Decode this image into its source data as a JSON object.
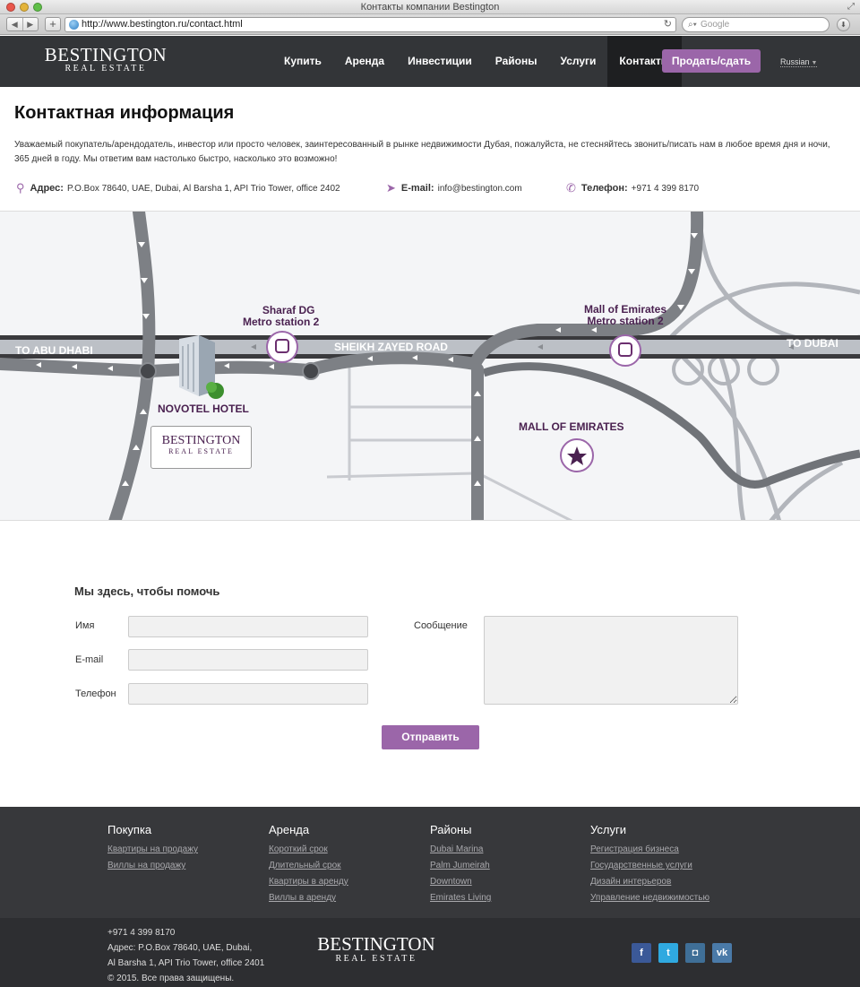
{
  "browser": {
    "window_title": "Контакты компании Bestington",
    "url": "http://www.bestington.ru/contact.html",
    "search_placeholder": "Google"
  },
  "header": {
    "logo_main": "BESTINGTON",
    "logo_sub": "REAL ESTATE",
    "nav": [
      {
        "label": "Купить"
      },
      {
        "label": "Аренда"
      },
      {
        "label": "Инвестиции"
      },
      {
        "label": "Районы"
      },
      {
        "label": "Услуги"
      },
      {
        "label": "Контакты",
        "active": true
      }
    ],
    "sell_button": "Продать/сдать",
    "language": "Russian"
  },
  "contact": {
    "title": "Контактная информация",
    "intro": "Уважаемый покупатель/арендодатель, инвестор или просто человек, заинтересованный в рынке недвижимости Дубая, пожалуйста, не стесняйтесь звонить/писать нам в любое время дня и ночи, 365 дней в году. Мы ответим вам настолько быстро, насколько это возможно!",
    "address_label": "Адрес:",
    "address_value": "P.O.Box 78640, UAE, Dubai, Al Barsha 1, API Trio Tower, office 2402",
    "email_label": "E-mail:",
    "email_value": "info@bestington.com",
    "phone_label": "Телефон:",
    "phone_value": "+971 4 399 8170"
  },
  "map": {
    "to_abu_dhabi": "TO ABU DHABI",
    "sheikh_zayed": "SHEIKH ZAYED ROAD",
    "to_dubai": "TO DUBAI",
    "sharaf_line1": "Sharaf DG",
    "sharaf_line2": "Metro station 2",
    "moe_station_line1": "Mall of Emirates",
    "moe_station_line2": "Metro station 2",
    "novotel": "NOVOTEL HOTEL",
    "mall": "MALL OF EMIRATES",
    "card_main": "BESTINGTON",
    "card_sub": "REAL ESTATE"
  },
  "form": {
    "title": "Мы здесь, чтобы помочь",
    "name_label": "Имя",
    "email_label": "E-mail",
    "phone_label": "Телефон",
    "message_label": "Сообщение",
    "submit": "Отправить"
  },
  "footer": {
    "columns": [
      {
        "title": "Покупка",
        "links": [
          "Квартиры на продажу",
          "Виллы на продажу"
        ]
      },
      {
        "title": "Аренда",
        "links": [
          "Короткий срок",
          "Длительный срок",
          "Квартиры в аренду",
          "Виллы в аренду"
        ]
      },
      {
        "title": "Районы",
        "links": [
          "Dubai Marina",
          "Palm Jumeirah",
          "Downtown",
          "Emirates Living"
        ]
      },
      {
        "title": "Услуги",
        "links": [
          "Регистрация бизнеса",
          "Государственные услуги",
          "Дизайн интерьеров",
          "Управление недвижимостью"
        ]
      }
    ],
    "phone": "+971 4 399 8170",
    "address_line1": "Адрес: P.O.Box 78640, UAE, Dubai,",
    "address_line2": "Al Barsha 1, API Trio Tower, office 2401",
    "copyright": "© 2015. Все права защищены.",
    "logo_main": "BESTINGTON",
    "logo_sub": "REAL ESTATE",
    "socials": [
      {
        "name": "facebook",
        "glyph": "f"
      },
      {
        "name": "twitter",
        "glyph": "t"
      },
      {
        "name": "instagram",
        "glyph": "◘"
      },
      {
        "name": "vkontakte",
        "glyph": "vk"
      }
    ]
  }
}
